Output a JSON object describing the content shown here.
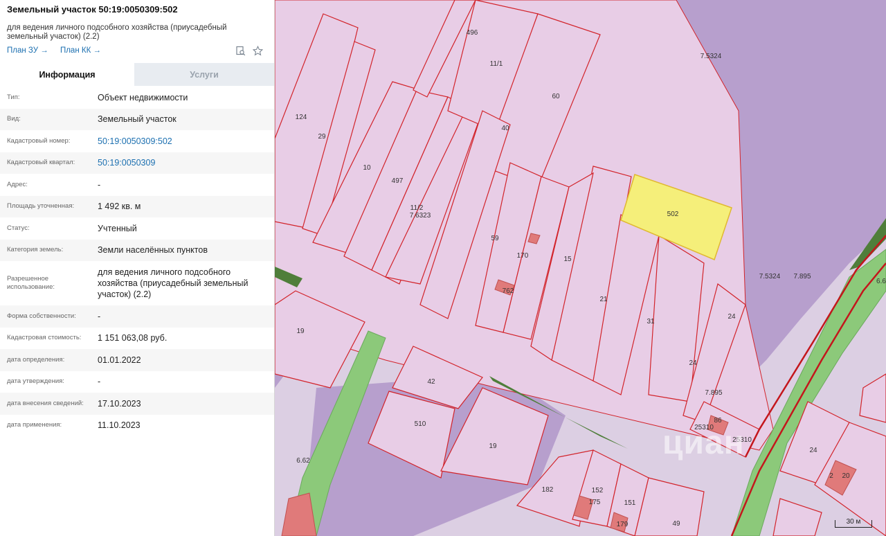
{
  "panel": {
    "title": "Земельный участок 50:19:0050309:502",
    "subtitle": "для ведения личного подсобного хозяйства (приусадебный земельный участок) (2.2)",
    "links": [
      "План ЗУ →",
      "План КК →"
    ],
    "icons": [
      "search-doc-icon",
      "star-icon"
    ],
    "tabs": [
      {
        "label": "Информация",
        "active": true
      },
      {
        "label": "Услуги",
        "active": false
      }
    ],
    "rows": [
      {
        "key": "Тип:",
        "value": "Объект недвижимости"
      },
      {
        "key": "Вид:",
        "value": "Земельный участок"
      },
      {
        "key": "Кадастровый номер:",
        "value": "50:19:0050309:502",
        "link": true
      },
      {
        "key": "Кадастровый квартал:",
        "value": "50:19:0050309",
        "link": true
      },
      {
        "key": "Адрес:",
        "value": "-"
      },
      {
        "key": "Площадь уточненная:",
        "value": "1 492 кв. м"
      },
      {
        "key": "Статус:",
        "value": "Учтенный"
      },
      {
        "key": "Категория земель:",
        "value": "Земли населённых пунктов"
      },
      {
        "key": "Разрешенное использование:",
        "value": "для ведения личного подсобного хозяйства (приусадебный земельный участок) (2.2)"
      },
      {
        "key": "Форма собственности:",
        "value": "-"
      },
      {
        "key": "Кадастровая стоимость:",
        "value": "1 151 063,08 руб."
      },
      {
        "key": "дата определения:",
        "value": "01.01.2022"
      },
      {
        "key": "дата утверждения:",
        "value": "-"
      },
      {
        "key": "дата внесения сведений:",
        "value": "17.10.2023"
      },
      {
        "key": "дата применения:",
        "value": "11.10.2023"
      }
    ]
  },
  "map": {
    "scale": "30 м",
    "watermark": "циан",
    "colors": {
      "parcel_fill": "#e8cde6",
      "parcel_stroke": "#d2232a",
      "selected_fill": "#f5ef7a",
      "green": "#8cc97a",
      "dark_green": "#4f7e3a",
      "purple": "#b79fcd",
      "building": "#e07a7a"
    },
    "labels": [
      "496",
      "11/1",
      "60",
      "7.5324",
      "124",
      "29",
      "40",
      "10",
      "497",
      "11/2",
      "7.6323",
      "502",
      "59",
      "170",
      "15",
      "762",
      "21",
      "31",
      "24",
      "7.5324",
      "7.895",
      "19",
      "42",
      "510",
      "19",
      "24",
      "7.895",
      "25310",
      "86",
      "25310",
      "6.62",
      "182",
      "152",
      "151",
      "175",
      "179",
      "49",
      "24",
      "2",
      "20",
      "6.6"
    ]
  }
}
